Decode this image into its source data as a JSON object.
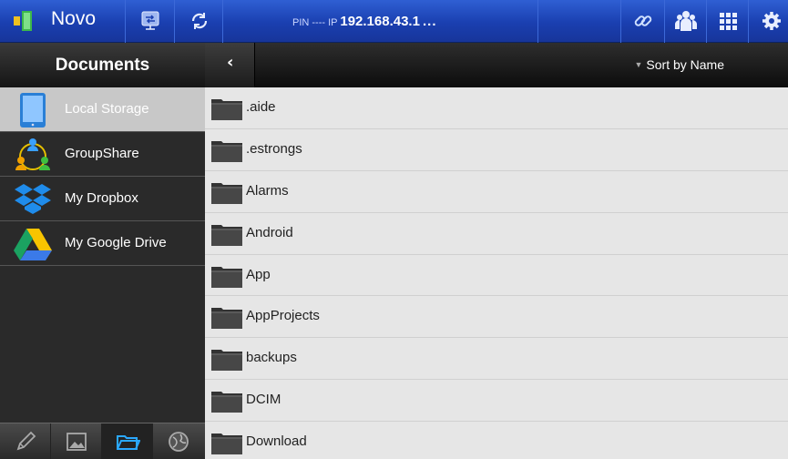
{
  "topbar": {
    "app_name": "Novo",
    "pin_label": "PIN ---- IP",
    "ip": "192.168.43.1",
    "more": "..."
  },
  "sidebar": {
    "title": "Documents",
    "items": [
      {
        "label": "Local Storage",
        "icon": "tablet-icon",
        "active": true
      },
      {
        "label": "GroupShare",
        "icon": "groupshare-icon"
      },
      {
        "label": "My Dropbox",
        "icon": "dropbox-icon"
      },
      {
        "label": "My Google Drive",
        "icon": "google-drive-icon"
      }
    ],
    "bottom_tabs": [
      "pencil-icon",
      "image-icon",
      "folder-icon",
      "globe-icon"
    ]
  },
  "main": {
    "back": "‹",
    "sort_label": "Sort by Name",
    "files": [
      ".aide",
      ".estrongs",
      "Alarms",
      "Android",
      "App",
      "AppProjects",
      "backups",
      "DCIM",
      "Download"
    ]
  },
  "colors": {
    "accent": "#1e45c0",
    "folder": "#3a3a3a"
  }
}
